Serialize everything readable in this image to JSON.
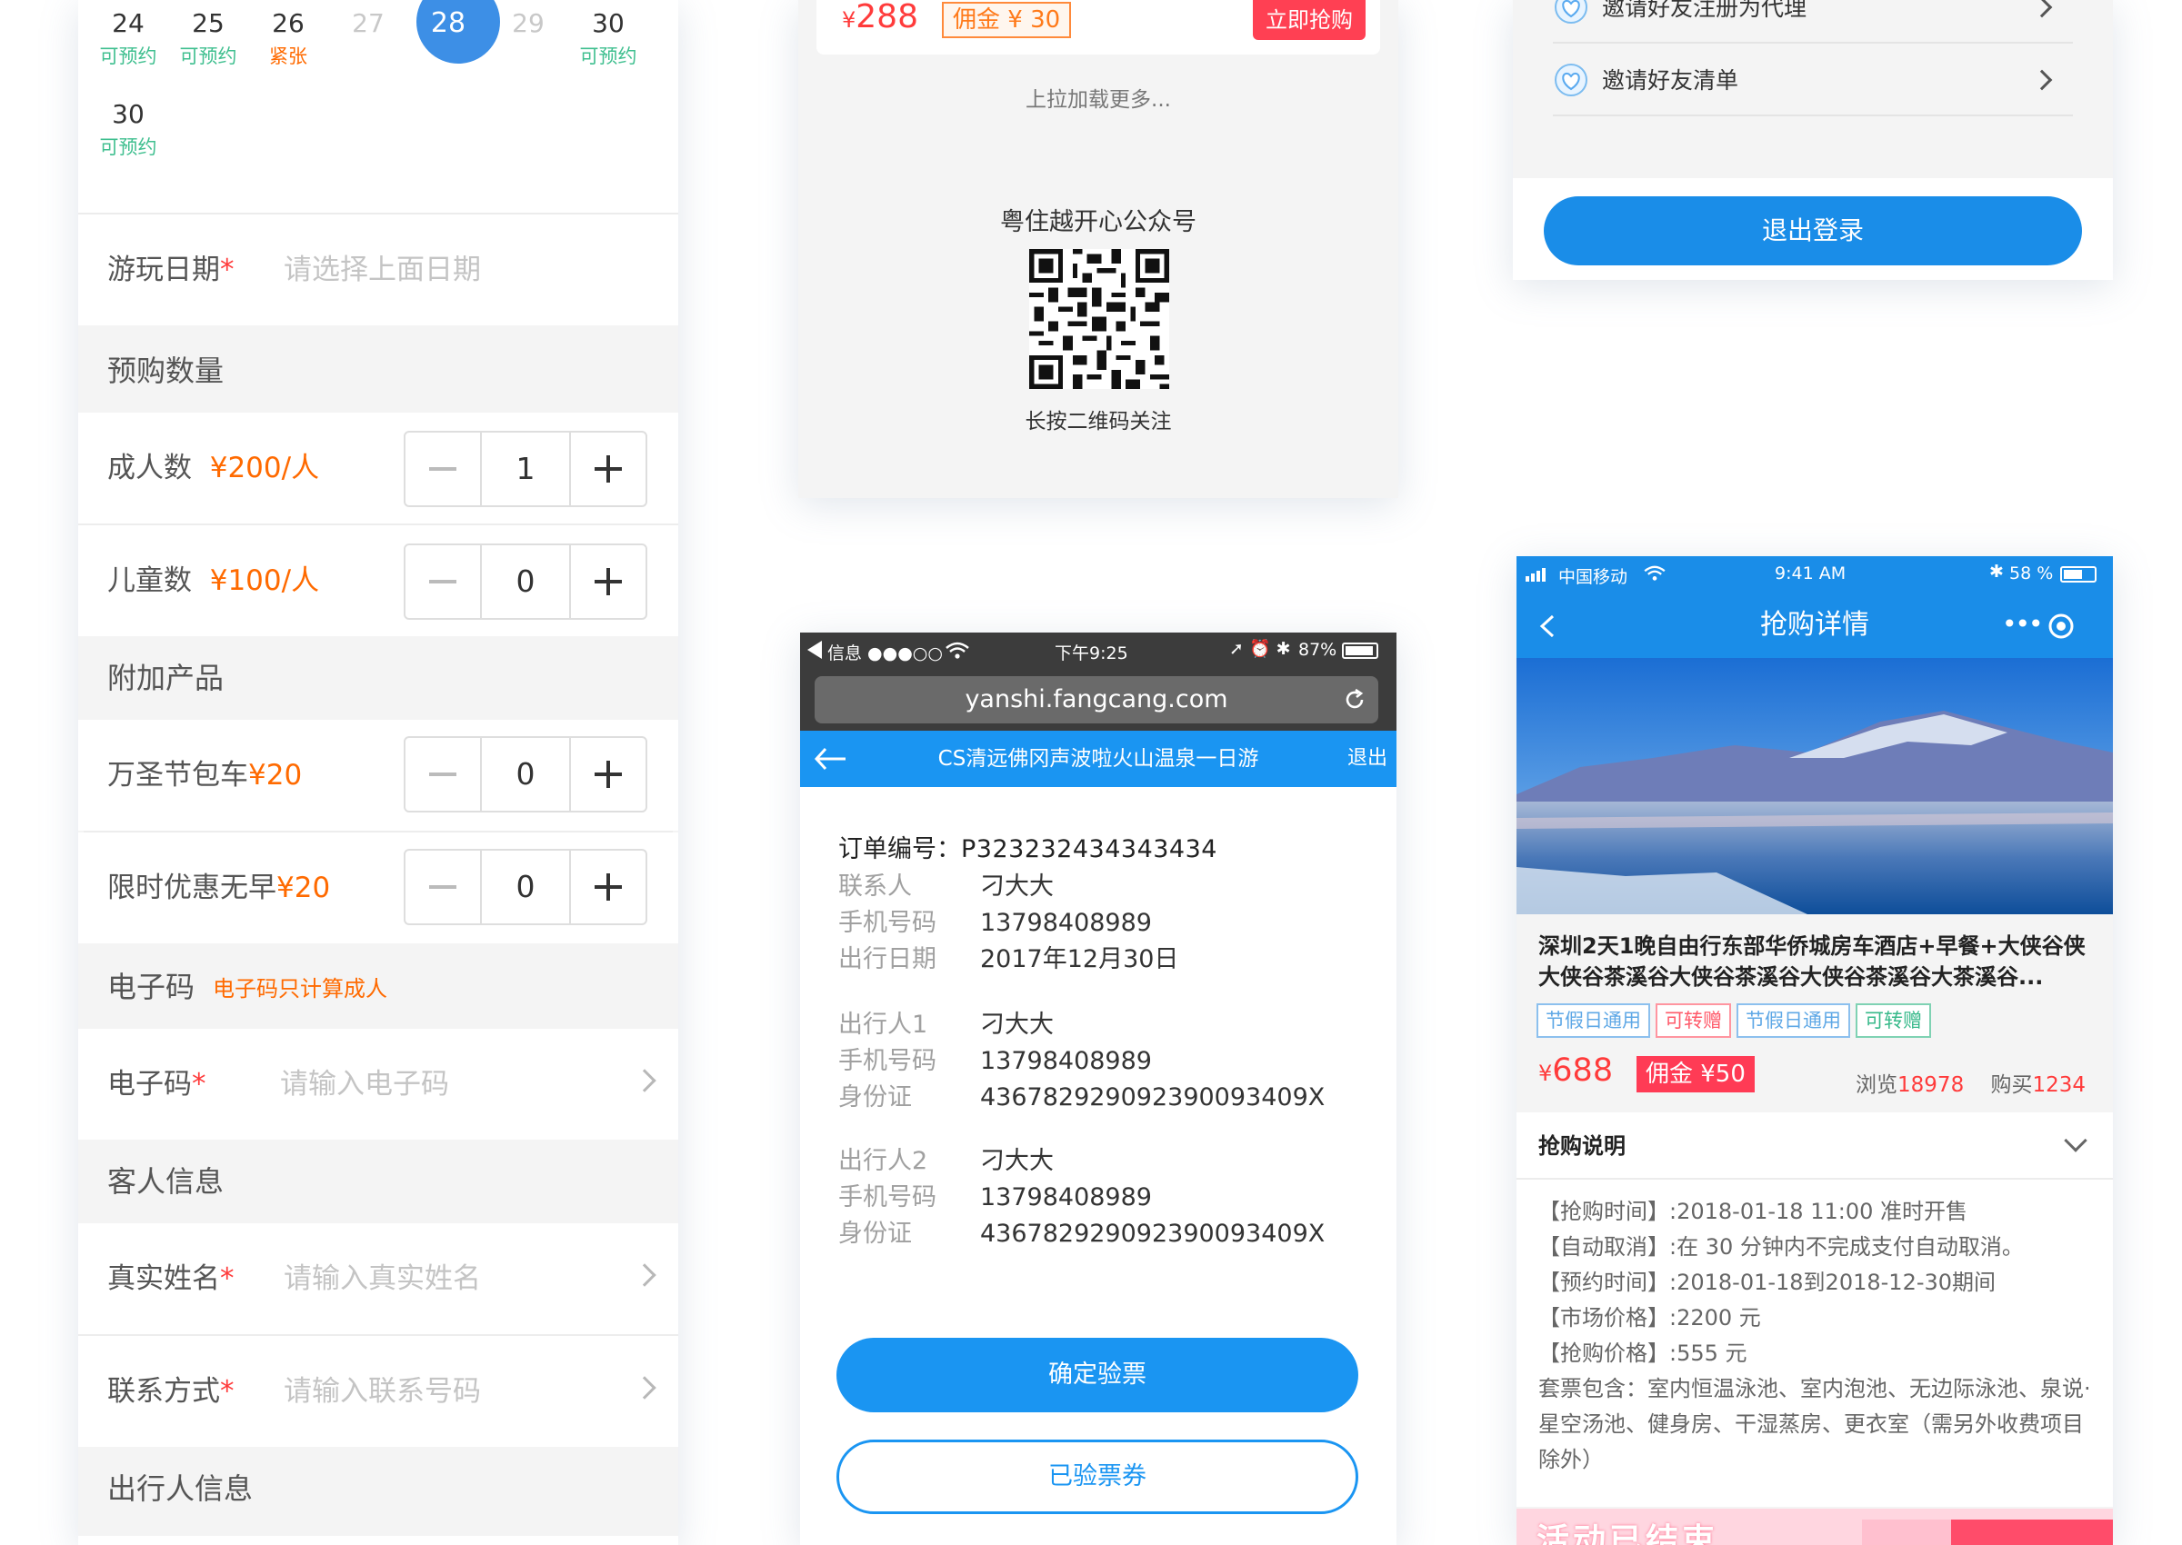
{
  "booking": {
    "calendar": {
      "row1": [
        {
          "day": "24",
          "status": "可预约",
          "kind": "ok"
        },
        {
          "day": "25",
          "status": "可预约",
          "kind": "ok"
        },
        {
          "day": "26",
          "status": "紧张",
          "kind": "hot"
        },
        {
          "day": "27",
          "status": "",
          "kind": "disabled"
        },
        {
          "day": "28",
          "status": "",
          "kind": "selected"
        },
        {
          "day": "29",
          "status": "",
          "kind": "disabled"
        },
        {
          "day": "30",
          "status": "可预约",
          "kind": "ok"
        }
      ],
      "row2": [
        {
          "day": "30",
          "status": "可预约",
          "kind": "ok"
        }
      ]
    },
    "play_date": {
      "label": "游玩日期",
      "required": "*",
      "placeholder": "请选择上面日期"
    },
    "qty_section": "预购数量",
    "adult": {
      "label": "成人数",
      "price": "¥200",
      "unit": "/人",
      "value": "1"
    },
    "child": {
      "label": "儿童数",
      "price": "¥100",
      "unit": "/人",
      "value": "0"
    },
    "addon_section": "附加产品",
    "addon1": {
      "label": "万圣节包车",
      "price": "¥20",
      "value": "0"
    },
    "addon2": {
      "label": "限时优惠无早",
      "price": "¥20",
      "value": "0"
    },
    "ecode_section": {
      "title": "电子码",
      "note": "电子码只计算成人"
    },
    "ecode": {
      "label": "电子码",
      "required": "*",
      "placeholder": "请输入电子码"
    },
    "guest_section": "客人信息",
    "real_name": {
      "label": "真实姓名",
      "required": "*",
      "placeholder": "请输入真实姓名"
    },
    "contact": {
      "label": "联系方式",
      "required": "*",
      "placeholder": "请输入联系号码"
    },
    "traveler_section": "出行人信息"
  },
  "product_list": {
    "price_symbol": "¥",
    "price": "288",
    "commission": "佣金 ¥ 30",
    "buy_label": "立即抢购",
    "load_more": "上拉加载更多...",
    "gzh_title": "粤住越开心公众号",
    "qr_tip": "长按二维码关注"
  },
  "verify": {
    "status_bar": {
      "carrier": "信息 ●●●○○",
      "time": "下午9:25",
      "battery": "87%"
    },
    "url": "yanshi.fangcang.com",
    "nav_title": "CS清远佛冈声波啦火山温泉一日游",
    "nav_exit": "退出",
    "order_label": "订单编号：",
    "order_no": "P323232434343434",
    "contact": [
      {
        "k": "联系人",
        "v": "刁大大"
      },
      {
        "k": "手机号码",
        "v": "13798408989"
      },
      {
        "k": "出行日期",
        "v": "2017年12月30日"
      }
    ],
    "traveler1": [
      {
        "k": "出行人1",
        "v": "刁大大"
      },
      {
        "k": "手机号码",
        "v": "13798408989"
      },
      {
        "k": "身份证",
        "v": "436782929092390093409X"
      }
    ],
    "traveler2": [
      {
        "k": "出行人2",
        "v": "刁大大"
      },
      {
        "k": "手机号码",
        "v": "13798408989"
      },
      {
        "k": "身份证",
        "v": "436782929092390093409X"
      }
    ],
    "confirm_btn": "确定验票",
    "verified_btn": "已验票券"
  },
  "account": {
    "invite_register": "邀请好友注册为代理",
    "invite_list": "邀请好友清单",
    "logout": "退出登录"
  },
  "flash": {
    "status_bar": {
      "carrier": "中国移动",
      "time": "9:41 AM",
      "battery": "58 %"
    },
    "nav_title": "抢购详情",
    "title": "深圳2天1晚自由行东部华侨城房车酒店+早餐+大侠谷侠大侠谷茶溪谷大侠谷茶溪谷大侠谷茶溪谷大茶溪谷...",
    "tags": [
      {
        "text": "节假日通用",
        "color": "b"
      },
      {
        "text": "可转赠",
        "color": "r"
      },
      {
        "text": "节假日通用",
        "color": "b"
      },
      {
        "text": "可转赠",
        "color": "g"
      }
    ],
    "price_symbol": "¥",
    "price": "688",
    "commission": "佣金 ¥50",
    "views_label": "浏览",
    "views": "18978",
    "bought_label": "购买",
    "bought": "1234",
    "section_title": "抢购说明",
    "desc": [
      "【抢购时间】:2018-01-18 11:00 准时开售",
      "【自动取消】:在 30 分钟内不完成支付自动取消。",
      "【预约时间】:2018-01-18到2018-12-30期间",
      "【市场价格】:2200 元",
      "【抢购价格】:555 元",
      "套票包含：室内恒温泳池、室内泡池、无边际泳池、泉说·星空汤池、健身房、干湿蒸房、更衣室（需另外收费项目除外）"
    ],
    "ended": "活动已结束"
  },
  "colors": {
    "primary_blue": "#1a95f2",
    "price_red": "#ff3b3b",
    "price_orange": "#ff6a00",
    "ok_green": "#3fbf8f",
    "selected_blue": "#3d8fe6"
  }
}
